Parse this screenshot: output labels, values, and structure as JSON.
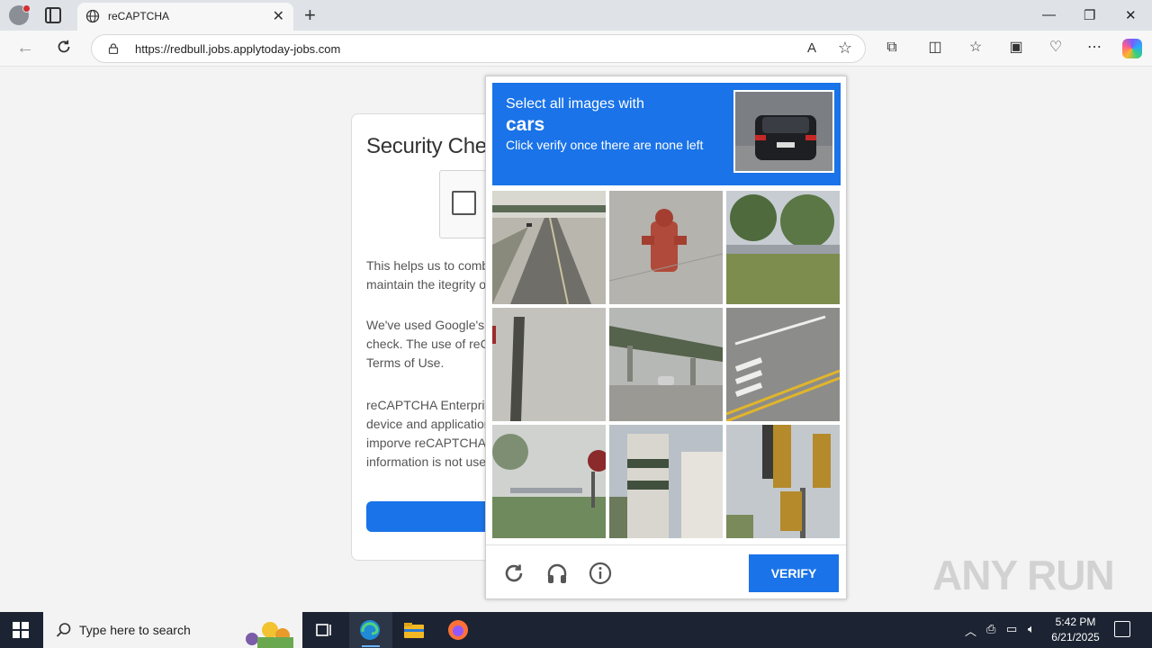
{
  "browser": {
    "tab_title": "reCAPTCHA",
    "url": "https://redbull.jobs.applytoday-jobs.com",
    "read_aloud_label": "A"
  },
  "page": {
    "heading": "Security Chec",
    "para1_line1": "This helps us to comba",
    "para1_line2": "maintain the itegrity of",
    "para2_line1": "We've used Google's r",
    "para2_line2": "check. The use of reC",
    "para2_line3": "Terms of Use.",
    "para3_line1": "reCAPTCHA Enterpris",
    "para3_line2": "device and application",
    "para3_line3": "imporve reCAPTCHA",
    "para3_line4": "information is not used"
  },
  "captcha": {
    "instruction": "Select all images with",
    "target": "cars",
    "subtext": "Click verify once there are none left",
    "verify_label": "VERIFY",
    "tiles": [
      {
        "name": "tile-highway-overpass"
      },
      {
        "name": "tile-fire-hydrant"
      },
      {
        "name": "tile-trees-grass"
      },
      {
        "name": "tile-pole"
      },
      {
        "name": "tile-overpass-car"
      },
      {
        "name": "tile-crosswalk"
      },
      {
        "name": "tile-palm-trees-sign"
      },
      {
        "name": "tile-building"
      },
      {
        "name": "tile-traffic-lights"
      }
    ]
  },
  "watermark": "ANY RUN",
  "taskbar": {
    "search_placeholder": "Type here to search",
    "time": "5:42 PM",
    "date": "6/21/2025"
  }
}
